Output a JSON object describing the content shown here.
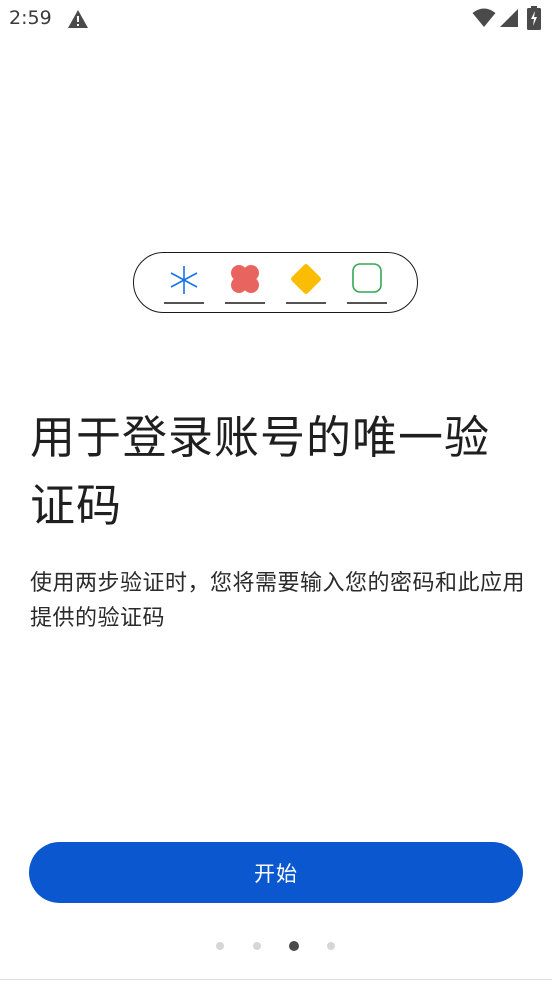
{
  "status_bar": {
    "time": "2:59",
    "icons": [
      "warning-icon",
      "wifi-icon",
      "signal-icon",
      "battery-charging-icon"
    ]
  },
  "illustration": {
    "items": [
      {
        "icon": "asterisk-icon",
        "color": "#1a73e8"
      },
      {
        "icon": "flower-icon",
        "color": "#e8655f"
      },
      {
        "icon": "diamond-icon",
        "color": "#fbbc04"
      },
      {
        "icon": "rounded-square-icon",
        "color": "#34a853"
      }
    ]
  },
  "content": {
    "headline": "用于登录账号的唯一验证码",
    "description": "使用两步验证时，您将需要输入您的密码和此应用提供的验证码"
  },
  "actions": {
    "start_label": "开始"
  },
  "pagination": {
    "total": 4,
    "active_index": 2
  },
  "colors": {
    "primary": "#0b57d0",
    "text": "#1f1f1f"
  }
}
